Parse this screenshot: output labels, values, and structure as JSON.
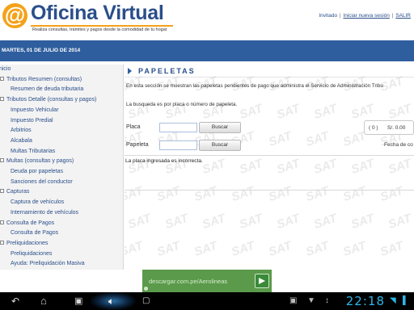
{
  "header": {
    "logo_symbol": "@",
    "title": "Oficina Virtual",
    "subtitle": "Realiza consultas, trámites y pagos desde la comodidad de tu hogar",
    "user_links": {
      "invitado": "Invitado",
      "separator": "|",
      "new_session": "Iniciar nueva sesión",
      "logout": "SALIR"
    }
  },
  "date_bar": {
    "date": "MARTES, 01 DE JULIO DE 2014"
  },
  "sidebar": {
    "items": [
      {
        "label": "Inicio",
        "level": 0,
        "expander": false
      },
      {
        "label": "Tributos Resumen (consultas)",
        "level": 0,
        "expander": true
      },
      {
        "label": "Resumen de deuda tributaria",
        "level": 1,
        "expander": false
      },
      {
        "label": "Tributos Detalle (consultas y pagos)",
        "level": 0,
        "expander": true
      },
      {
        "label": "Impuesto Vehicular",
        "level": 1,
        "expander": false
      },
      {
        "label": "Impuesto Predial",
        "level": 1,
        "expander": false
      },
      {
        "label": "Arbitrios",
        "level": 1,
        "expander": false
      },
      {
        "label": "Alcabala",
        "level": 1,
        "expander": false
      },
      {
        "label": "Multas Tributarias",
        "level": 1,
        "expander": false
      },
      {
        "label": "Multas (consultas y pagos)",
        "level": 0,
        "expander": true
      },
      {
        "label": "Deuda por papeletas",
        "level": 1,
        "expander": false
      },
      {
        "label": "Sanciones del conductor",
        "level": 1,
        "expander": false
      },
      {
        "label": "Capturas",
        "level": 0,
        "expander": true
      },
      {
        "label": "Captura de vehículos",
        "level": 1,
        "expander": false
      },
      {
        "label": "Internamiento de vehículos",
        "level": 1,
        "expander": false
      },
      {
        "label": "Consulta de Pagos",
        "level": 0,
        "expander": true
      },
      {
        "label": "Consulta de Pagos",
        "level": 1,
        "expander": false
      },
      {
        "label": "Preliquidaciones",
        "level": 0,
        "expander": true
      },
      {
        "label": "Preliquidaciones",
        "level": 1,
        "expander": false
      },
      {
        "label": "Ayuda: Preliquidación Masiva",
        "level": 1,
        "expander": false
      }
    ]
  },
  "main": {
    "section_title": "PAPELETAS",
    "intro": "En esta sección se muestran las papeletas pendientes de pago que administra el Servicio de Administración Tribu",
    "hint": "La busqueda es por placa o número de papeleta.",
    "placa": {
      "label": "Placa",
      "value": "",
      "button": "Buscar"
    },
    "papeleta": {
      "label": "Papeleta",
      "value": "",
      "button": "Buscar"
    },
    "summary": {
      "count": "( 0 )",
      "amount": "S/. 0.00"
    },
    "fecha_label": "Fecha de co",
    "error": "La placa ingresada es incorrecta.",
    "watermark_text": "SAT"
  },
  "ad": {
    "text": "descargar.com.pe/Aerolineas"
  },
  "system_bar": {
    "clock": "22:18",
    "icons": [
      "back-icon",
      "home-icon",
      "recent-apps-icon",
      "volume-icon",
      "screenshot-icon",
      "gallery-icon",
      "download-icon",
      "usb-icon",
      "wifi-icon"
    ]
  }
}
